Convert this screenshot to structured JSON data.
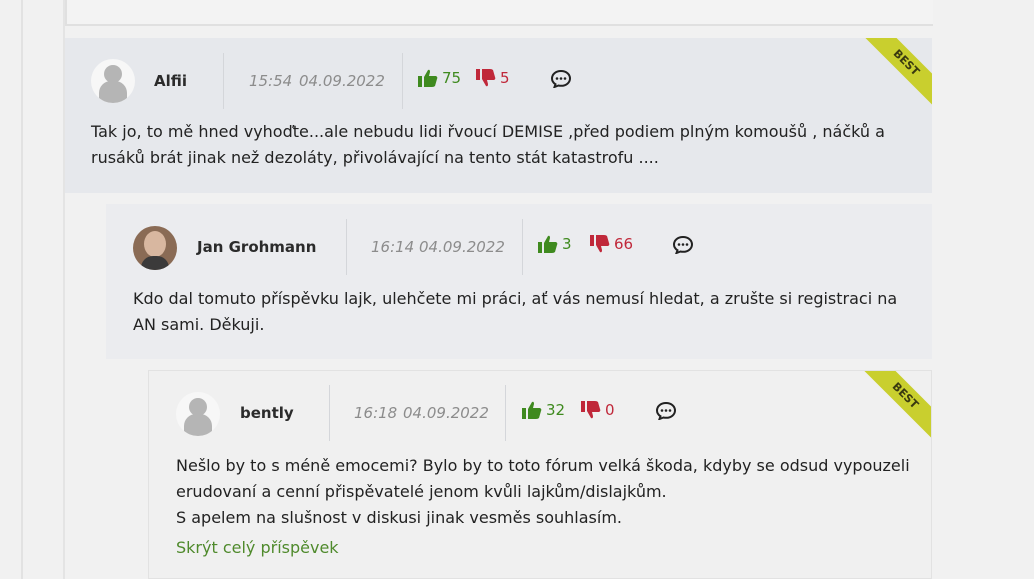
{
  "comments": [
    {
      "author": "Alfii",
      "time": "15:54",
      "date": "04.09.2022",
      "likes": "75",
      "dislikes": "5",
      "best": "BEST",
      "text": "Tak jo, to mě hned vyhoďte...ale nebudu lidi řvoucí DEMISE ,před podiem plným komoušů , náčků a rusáků brát jinak než dezoláty, přivolávající na tento stát katastrofu ...."
    },
    {
      "author": "Jan Grohmann",
      "time": "16:14",
      "date": "04.09.2022",
      "likes": "3",
      "dislikes": "66",
      "text": "Kdo dal tomuto příspěvku lajk, ulehčete mi práci, ať vás nemusí hledat, a zrušte si registraci na AN sami. Děkuji."
    },
    {
      "author": "bently",
      "time": "16:18",
      "date": "04.09.2022",
      "likes": "32",
      "dislikes": "0",
      "best": "BEST",
      "text_lines": [
        "Nešlo by to s méně emocemi? Bylo by to toto fórum velká škoda, kdyby se odsud vypouzeli",
        "erudovaní a cenní přispěvatelé jenom kvůli lajkům/dislajkům.",
        "S apelem na slušnost v diskusi jinak vesměs souhlasím."
      ],
      "hide_link": "Skrýt celý příspěvek"
    }
  ],
  "colors": {
    "like": "#3f8a1f",
    "dislike": "#c0283a",
    "best_ribbon": "#c9cf2e",
    "link": "#4f8a2c"
  },
  "icons": [
    "thumbs-up-icon",
    "thumbs-down-icon",
    "reply-bubble-icon",
    "avatar-placeholder-icon"
  ]
}
